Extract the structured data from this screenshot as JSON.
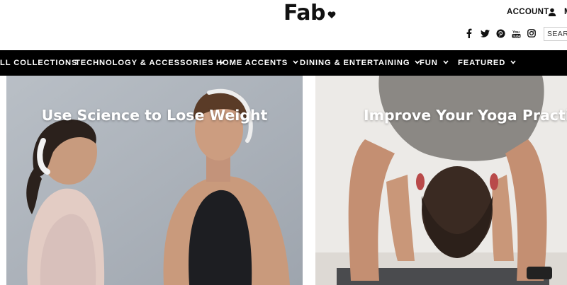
{
  "header": {
    "logo_text": "Fab",
    "account_label": "ACCOUNT",
    "cut_label": "M",
    "search_placeholder": "SEARCH",
    "social_icons": [
      "facebook-icon",
      "twitter-icon",
      "pinterest-icon",
      "youtube-icon",
      "instagram-icon"
    ]
  },
  "nav": {
    "items": [
      {
        "label": "ALL COLLECTIONS",
        "has_dropdown": false
      },
      {
        "label": "TECHNOLOGY & ACCESSORIES",
        "has_dropdown": true
      },
      {
        "label": "HOME ACCENTS",
        "has_dropdown": true
      },
      {
        "label": "DINING & ENTERTAINING",
        "has_dropdown": true
      },
      {
        "label": "FUN",
        "has_dropdown": true
      },
      {
        "label": "FEATURED",
        "has_dropdown": true
      }
    ]
  },
  "banners": [
    {
      "title": "Use Science to Lose Weight"
    },
    {
      "title": "Improve Your Yoga Practice"
    }
  ],
  "colors": {
    "nav_bg": "#000000",
    "nav_text": "#ffffff",
    "accent": "#111111"
  }
}
